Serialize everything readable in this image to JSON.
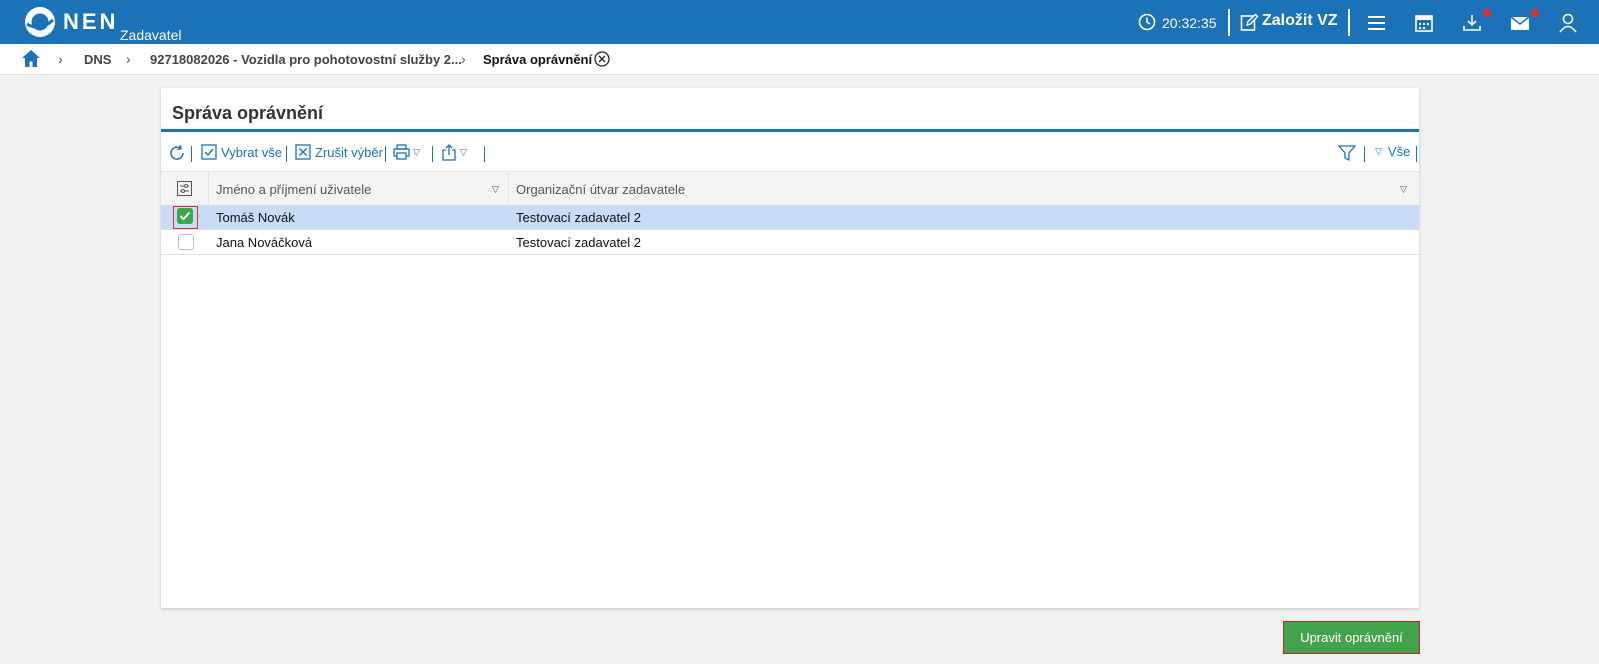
{
  "header": {
    "brand": "NEN",
    "brand_sub": "Zadavatel",
    "time": "20:32:35",
    "create_label": "Založit VZ",
    "icons": [
      "clock-icon",
      "edit-icon",
      "menu-icon",
      "calendar-icon",
      "download-icon",
      "mail-icon",
      "user-icon"
    ],
    "notification_color": "#e0302d",
    "brand_color": "#1b72b6"
  },
  "breadcrumb": {
    "items": [
      "DNS",
      "92718082026 - Vozidla pro pohotovostní služby 2...",
      "Správa oprávnění"
    ]
  },
  "panel": {
    "title": "Správa oprávnění",
    "toolbar": {
      "select_all": "Vybrat vše",
      "clear_selection": "Zrušit výběr",
      "filter_all": "Vše"
    },
    "columns": [
      "Jméno a příjmení uživatele",
      "Organizační útvar zadavatele"
    ],
    "rows": [
      {
        "name": "Tomáš Novák",
        "unit": "Testovací zadavatel 2",
        "selected": true
      },
      {
        "name": "Jana Nováčková",
        "unit": "Testovací zadavatel 2",
        "selected": false
      }
    ]
  },
  "actions": {
    "edit_permissions": "Upravit oprávnění",
    "accent_color": "#43a34d"
  }
}
